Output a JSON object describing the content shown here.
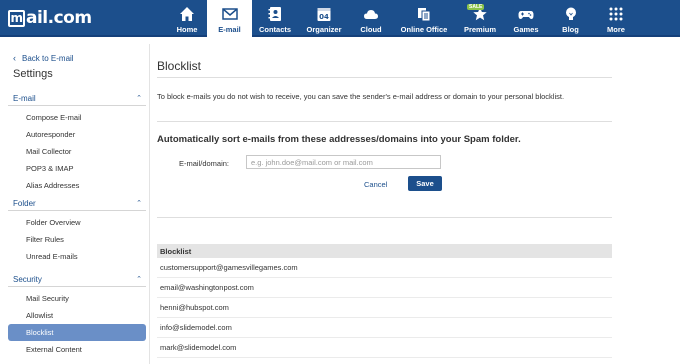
{
  "brand": {
    "logo_text": "mail.com"
  },
  "nav": [
    {
      "label": "Home",
      "icon": "home-icon"
    },
    {
      "label": "E-mail",
      "icon": "envelope-icon",
      "active": true
    },
    {
      "label": "Contacts",
      "icon": "contacts-icon"
    },
    {
      "label": "Organizer",
      "icon": "calendar-icon",
      "icon_text": "04"
    },
    {
      "label": "Cloud",
      "icon": "cloud-icon"
    },
    {
      "label": "Online Office",
      "icon": "office-icon"
    },
    {
      "label": "Premium",
      "icon": "star-icon",
      "badge": "SALE"
    },
    {
      "label": "Games",
      "icon": "gamepad-icon"
    },
    {
      "label": "Blog",
      "icon": "lightbulb-icon"
    },
    {
      "label": "More",
      "icon": "grid-icon"
    }
  ],
  "sidebar": {
    "back_label": "Back to E-mail",
    "title": "Settings",
    "sections": [
      {
        "label": "E-mail",
        "items": [
          "Compose E-mail",
          "Autoresponder",
          "Mail Collector",
          "POP3 & IMAP",
          "Alias Addresses"
        ]
      },
      {
        "label": "Folder",
        "items": [
          "Folder Overview",
          "Filter Rules",
          "Unread E-mails"
        ]
      },
      {
        "label": "Security",
        "items": [
          "Mail Security",
          "Allowlist",
          "Blocklist",
          "External Content"
        ]
      }
    ],
    "active_item": "Blocklist"
  },
  "main": {
    "title": "Blocklist",
    "intro": "To block e-mails you do not wish to receive, you can save the sender's e-mail address or domain to your personal blocklist.",
    "subheading": "Automatically sort e-mails from these addresses/domains into your Spam folder.",
    "form": {
      "label": "E-mail/domain:",
      "placeholder": "e.g. john.doe@mail.com or mail.com",
      "value": "",
      "cancel_label": "Cancel",
      "save_label": "Save"
    },
    "table": {
      "header": "Blocklist",
      "rows": [
        "customersupport@gamesvillegames.com",
        "email@washingtonpost.com",
        "henni@hubspot.com",
        "info@slidemodel.com",
        "mark@slidemodel.com"
      ]
    }
  },
  "colors": {
    "brand_blue": "#1c4f8c",
    "active_item": "#6a8fc7",
    "sale_badge": "#8bc34a"
  }
}
